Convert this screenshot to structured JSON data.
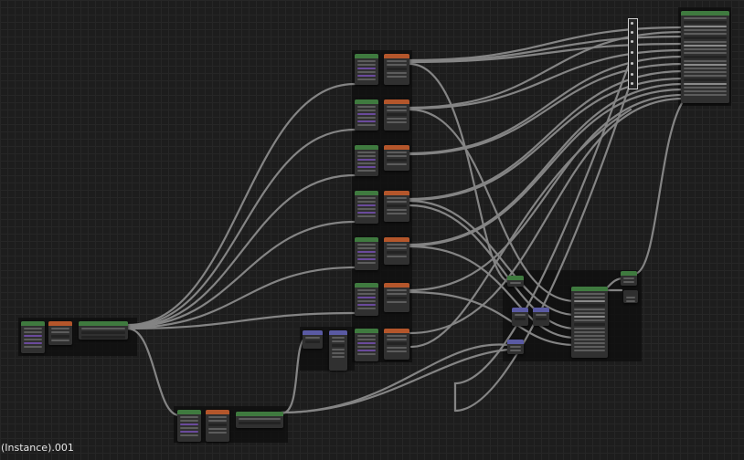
{
  "editor": {
    "name": "node-editor",
    "overlay_text": "(Instance).001"
  },
  "colors": {
    "background": "#1d1d1d",
    "grid": "#262626",
    "wire": "#8a8a8a",
    "frame": "#0c0c0c",
    "header_geometry": "#3f7a3f",
    "header_converter": "#b4562b",
    "header_input": "#5a5aa3",
    "header_output": "#3f7a3f",
    "socket_purple": "#6a4a9c"
  },
  "node_groups": [
    {
      "id": "group-1",
      "headers": [
        "geometry",
        "converter"
      ]
    },
    {
      "id": "group-2",
      "headers": [
        "geometry",
        "converter"
      ]
    },
    {
      "id": "group-3",
      "headers": [
        "geometry",
        "converter"
      ]
    },
    {
      "id": "group-4",
      "headers": [
        "geometry",
        "converter"
      ]
    },
    {
      "id": "group-5",
      "headers": [
        "geometry",
        "converter"
      ]
    },
    {
      "id": "group-6",
      "headers": [
        "geometry",
        "converter"
      ]
    },
    {
      "id": "group-7",
      "headers": [
        "input",
        "input",
        "geometry",
        "converter"
      ]
    }
  ],
  "output_node": {
    "name": "group-output",
    "header": "output"
  },
  "shader_node": {
    "name": "principled-node",
    "header": "shader"
  }
}
